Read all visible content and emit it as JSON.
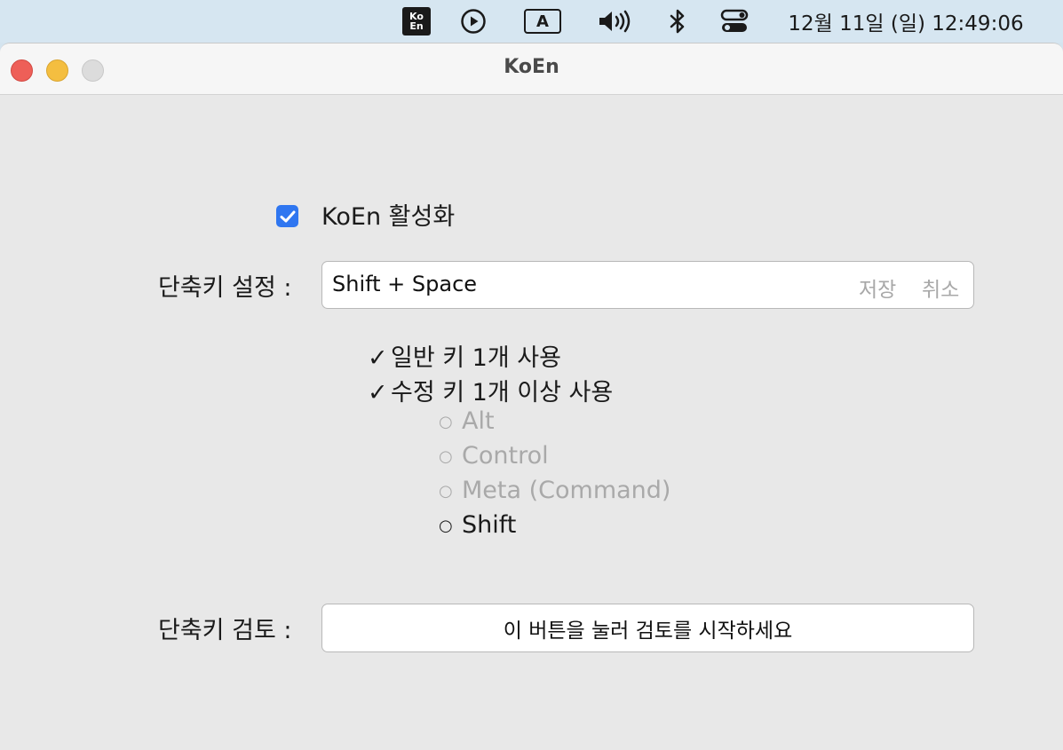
{
  "menubar": {
    "koen_icon_text": [
      "Ko",
      "En"
    ],
    "icons": [
      "koen-app-icon",
      "play-circle-icon",
      "input-source-a-icon",
      "volume-icon",
      "bluetooth-icon",
      "control-center-icon"
    ],
    "input_source_label": "A",
    "clock": "12월 11일 (일) 12:49:06"
  },
  "window": {
    "title": "KoEn"
  },
  "settings": {
    "enable_label": "KoEn 활성화",
    "enable_checked": true,
    "shortcut_label": "단축키 설정 :",
    "shortcut_value": "Shift + Space",
    "save_label": "저장",
    "cancel_label": "취소",
    "requirements": [
      {
        "mark": "✓",
        "text": "일반 키 1개 사용",
        "met": true
      },
      {
        "mark": "✓",
        "text": "수정 키 1개 이상 사용",
        "met": true
      }
    ],
    "modifiers": [
      {
        "name": "Alt",
        "active": false
      },
      {
        "name": "Control",
        "active": false
      },
      {
        "name": "Meta (Command)",
        "active": false
      },
      {
        "name": "Shift",
        "active": true
      }
    ],
    "review_label": "단축키 검토 :",
    "review_button": "이 버튼을 눌러 검토를 시작하세요"
  },
  "colors": {
    "accent": "#2f76f0",
    "dim_text": "#a9a9a9",
    "window_bg": "#e8e8e8"
  }
}
